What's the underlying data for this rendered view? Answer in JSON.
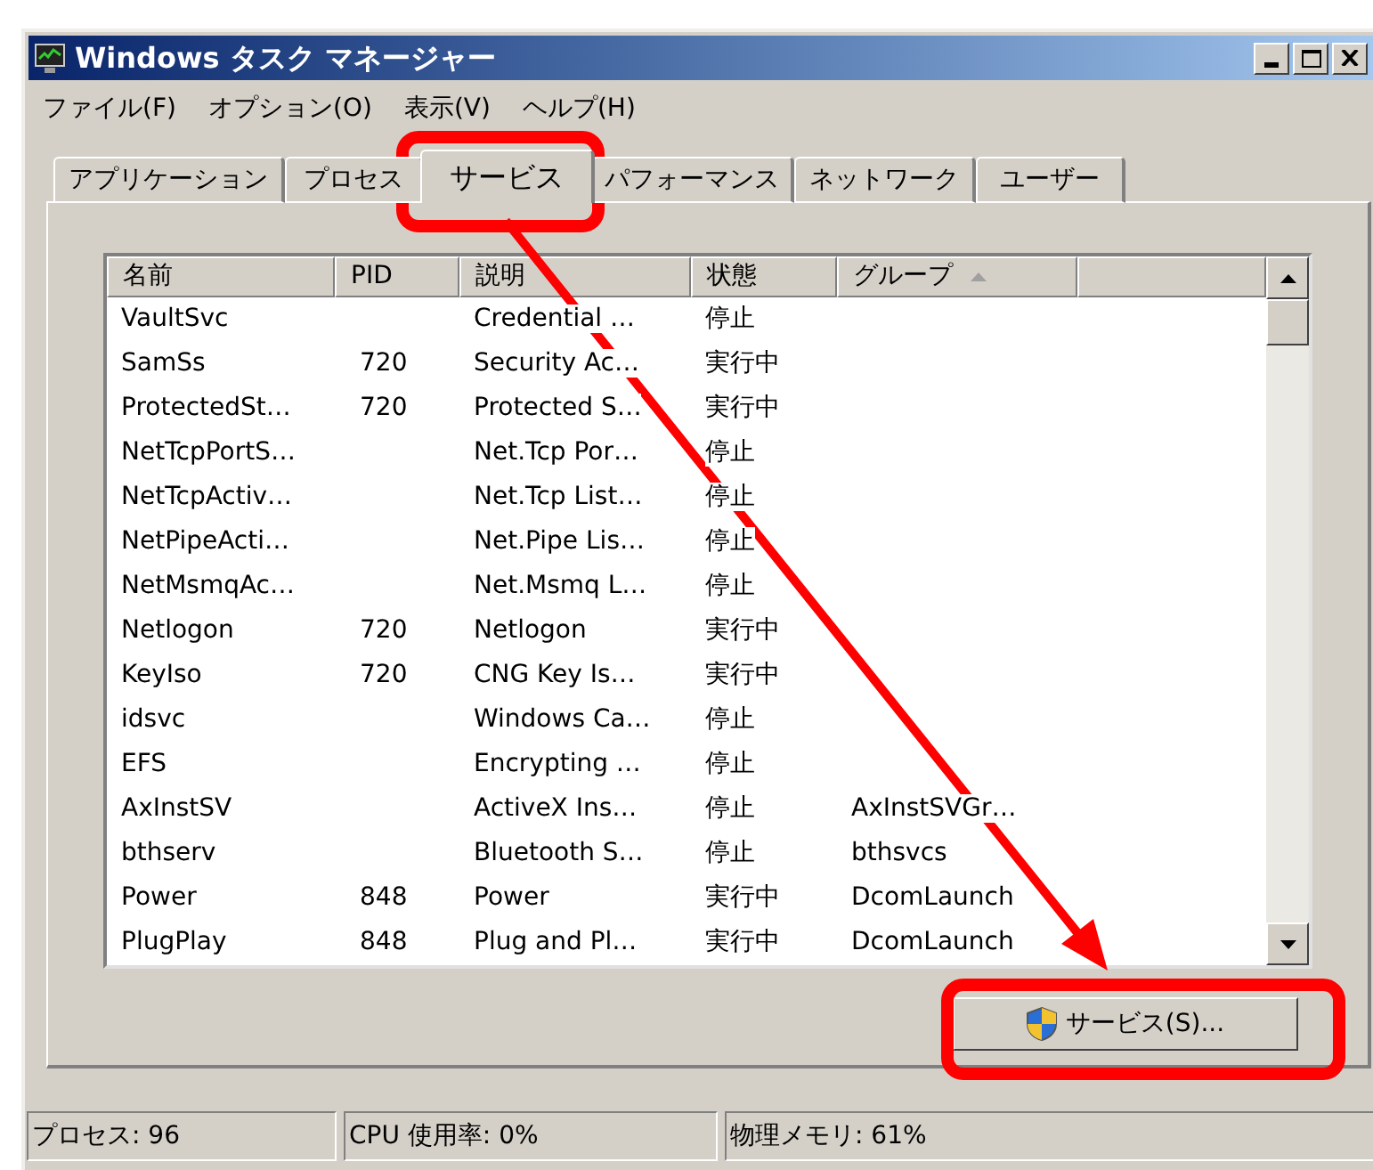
{
  "window": {
    "title": "Windows タスク マネージャー"
  },
  "menu": [
    "ファイル(F)",
    "オプション(O)",
    "表示(V)",
    "ヘルプ(H)"
  ],
  "tabs": [
    {
      "label": "アプリケーション",
      "selected": false
    },
    {
      "label": "プロセス",
      "selected": false
    },
    {
      "label": "サービス",
      "selected": true
    },
    {
      "label": "パフォーマンス",
      "selected": false
    },
    {
      "label": "ネットワーク",
      "selected": false
    },
    {
      "label": "ユーザー",
      "selected": false
    }
  ],
  "table": {
    "columns": [
      {
        "label": "名前",
        "sorted": false
      },
      {
        "label": "PID",
        "sorted": false
      },
      {
        "label": "説明",
        "sorted": false
      },
      {
        "label": "状態",
        "sorted": false
      },
      {
        "label": "グループ",
        "sorted": true
      }
    ],
    "rows": [
      [
        "VaultSvc",
        "",
        "Credential …",
        "停止",
        ""
      ],
      [
        "SamSs",
        "720",
        "Security Ac…",
        "実行中",
        ""
      ],
      [
        "ProtectedSt…",
        "720",
        "Protected S…",
        "実行中",
        ""
      ],
      [
        "NetTcpPortS…",
        "",
        "Net.Tcp Por…",
        "停止",
        ""
      ],
      [
        "NetTcpActiv…",
        "",
        "Net.Tcp List…",
        "停止",
        ""
      ],
      [
        "NetPipeActi…",
        "",
        "Net.Pipe Lis…",
        "停止",
        ""
      ],
      [
        "NetMsmqAc…",
        "",
        "Net.Msmq L…",
        "停止",
        ""
      ],
      [
        "Netlogon",
        "720",
        "Netlogon",
        "実行中",
        ""
      ],
      [
        "KeyIso",
        "720",
        "CNG Key Is…",
        "実行中",
        ""
      ],
      [
        "idsvc",
        "",
        "Windows Ca…",
        "停止",
        ""
      ],
      [
        "EFS",
        "",
        "Encrypting …",
        "停止",
        ""
      ],
      [
        "AxInstSV",
        "",
        "ActiveX Ins…",
        "停止",
        "AxInstSVGr…"
      ],
      [
        "bthserv",
        "",
        "Bluetooth S…",
        "停止",
        "bthsvcs"
      ],
      [
        "Power",
        "848",
        "Power",
        "実行中",
        "DcomLaunch"
      ],
      [
        "PlugPlay",
        "848",
        "Plug and Pl…",
        "実行中",
        "DcomLaunch"
      ]
    ]
  },
  "services_button": {
    "label": "サービス(S)..."
  },
  "status_bar": [
    "プロセス: 96",
    "CPU 使用率: 0%",
    "物理メモリ: 61%"
  ],
  "callouts": [
    {
      "kind": "highlight"
    },
    {
      "kind": "arrow"
    },
    {
      "kind": "highlight"
    }
  ]
}
